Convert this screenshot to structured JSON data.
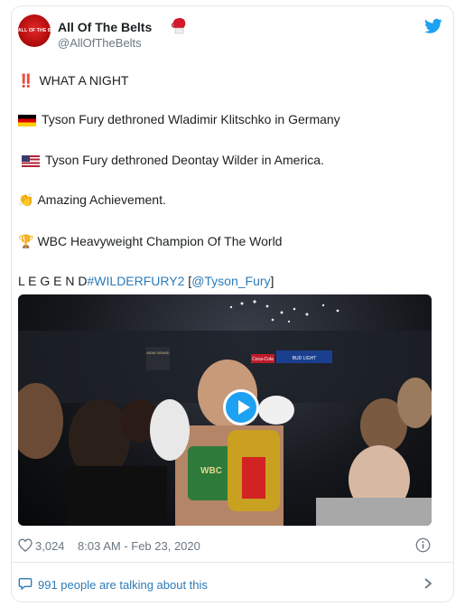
{
  "author": {
    "display_name": "All Of The Belts",
    "handle": "@AllOfTheBelts",
    "avatar_text": "ALL OF THE BELTS"
  },
  "tweet": {
    "line1": {
      "emoji": "‼️",
      "text": "WHAT A NIGHT"
    },
    "line2": {
      "icon": "germany-flag",
      "text": "Tyson Fury dethroned Wladimir Klitschko in Germany"
    },
    "line3": {
      "icon": "usa-flag",
      "text": "Tyson Fury dethroned Deontay Wilder in America."
    },
    "line4": {
      "emoji": "👏",
      "text": "Amazing Achievement."
    },
    "line5": {
      "emoji": "🏆",
      "text": "WBC Heavyweight Champion Of The World"
    },
    "line6": {
      "text": "L E G E N D",
      "hashtag": "#WILDERFURY2",
      "bracket_open": " [",
      "mention": "@Tyson_Fury",
      "bracket_close": "]"
    }
  },
  "video": {
    "ring_sign": "MGM GRAND",
    "sponsor1": "Coca-Cola",
    "sponsor2": "BUD LIGHT",
    "belt_text": "WBC"
  },
  "meta": {
    "likes": "3,024",
    "timestamp": "8:03 AM - Feb 23, 2020"
  },
  "footer": {
    "talking": "991 people are talking about this"
  },
  "colors": {
    "link": "#2b7bb9",
    "twitter_blue": "#1da1f2",
    "avatar_red": "#b70d0d"
  }
}
